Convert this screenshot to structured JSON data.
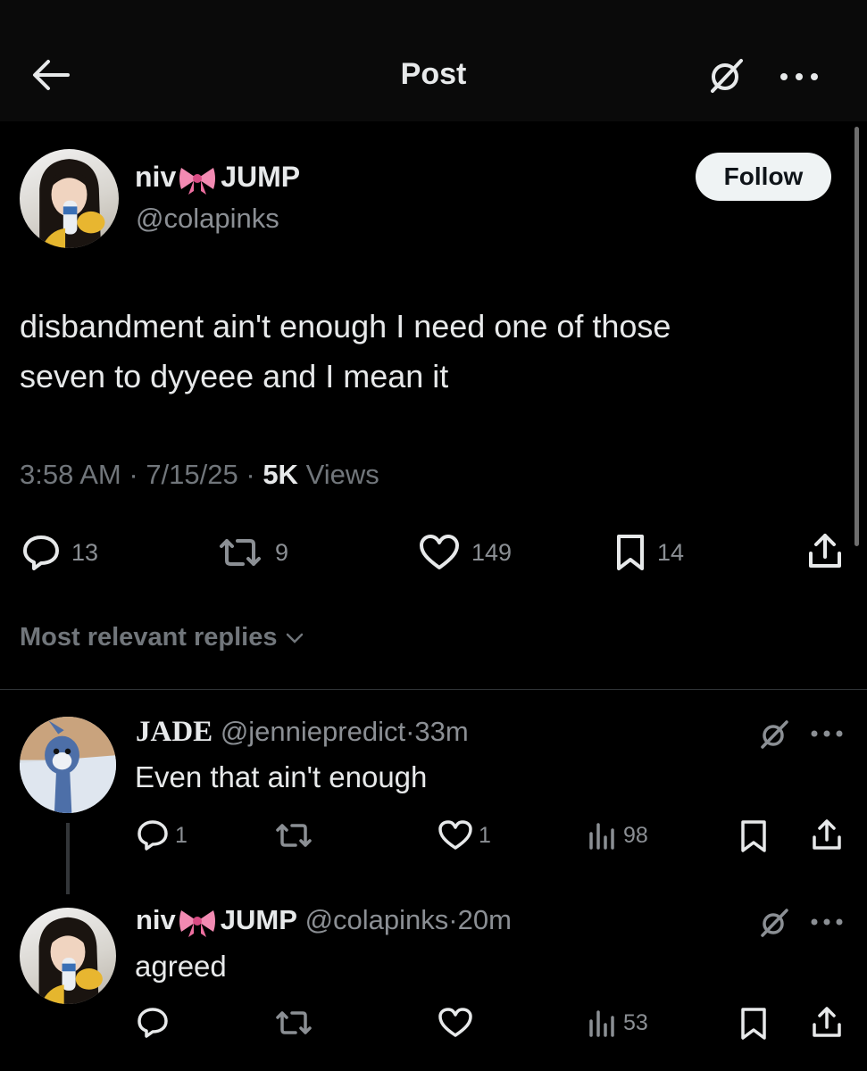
{
  "header": {
    "title": "Post",
    "back_icon": "arrow-left-icon",
    "grok_icon": "grok-icon",
    "more_icon": "more-icon"
  },
  "post": {
    "author_name": "niv",
    "author_name_suffix": "JUMP",
    "handle": "@colapinks",
    "follow_label": "Follow",
    "text_line1": "disbandment ain't enough I need one of those",
    "text_line2": "seven to dyyeee and I mean it",
    "time": "3:58 AM",
    "date": "7/15/25",
    "views_count": "5K",
    "views_label": "Views",
    "stats": {
      "replies": "13",
      "reposts": "9",
      "likes": "149",
      "bookmarks": "14"
    }
  },
  "replies_sort": {
    "label": "Most relevant replies"
  },
  "replies": [
    {
      "name": "JADE",
      "handle": "@jenniepredict",
      "time": "33m",
      "text": "Even that ain't enough",
      "replies": "1",
      "reposts": "",
      "likes": "1",
      "views": "98"
    },
    {
      "name": "niv",
      "name_suffix": "JUMP",
      "handle": "@colapinks",
      "time": "20m",
      "text": "agreed",
      "replies": "",
      "reposts": "",
      "likes": "",
      "views": "53"
    }
  ],
  "colors": {
    "background": "#000000",
    "text_primary": "#e7e9ea",
    "text_secondary": "#71767b",
    "follow_bg": "#eff3f4",
    "divider": "#2f3336"
  }
}
